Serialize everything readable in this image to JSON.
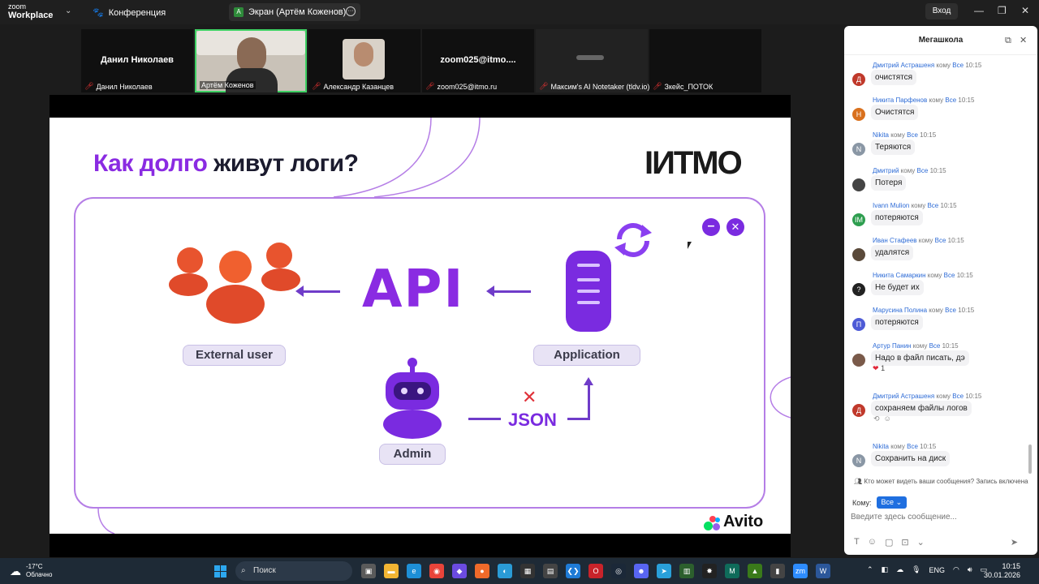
{
  "titlebar": {
    "logo_top": "zoom",
    "logo_bottom": "Workplace",
    "conference": "Конференция",
    "share_badge": "A",
    "share_tab": "Экран (Артём Коженов)",
    "login": "Вход"
  },
  "participants": [
    {
      "center": "Данил Николаев",
      "label": "Данил Николаев"
    },
    {
      "center": "",
      "label": "Артём Коженов"
    },
    {
      "center": "",
      "label": "Александр Казанцев"
    },
    {
      "center": "zoom025@itmo....",
      "label": "zoom025@itmo.ru"
    },
    {
      "center": "",
      "label": "Максим's AI Notetaker (tldv.io)"
    },
    {
      "center": "",
      "label": "Зкейс_ПОТОК"
    }
  ],
  "slide": {
    "title_highlight": "Как долго",
    "title_rest": " живут логи?",
    "brand": "IИTMO",
    "api": "API",
    "external_user": "External user",
    "application": "Application",
    "admin": "Admin",
    "json": "JSON",
    "avito": "Avito"
  },
  "chat": {
    "title": "Мегашкола",
    "to_word": "кому",
    "everyone": "Все",
    "messages": [
      {
        "name": "Дмитрий Астрашеня",
        "time": "10:15",
        "text": "очистятся",
        "avatar": "Д",
        "color": "#c0392b"
      },
      {
        "name": "Никита Парфенов",
        "time": "10:15",
        "text": "Очистятся",
        "avatar": "Н",
        "color": "#d9711e"
      },
      {
        "name": "Nikita",
        "time": "10:15",
        "text": "Теряются",
        "avatar": "N",
        "color": "#8a97a5"
      },
      {
        "name": "Дмитрий",
        "time": "10:15",
        "text": "Потеря",
        "avatar": "",
        "color": "#444"
      },
      {
        "name": "Ivann Mulion",
        "time": "10:15",
        "text": "потеряются",
        "avatar": "IM",
        "color": "#2e9e4f"
      },
      {
        "name": "Иван Стафеев",
        "time": "10:15",
        "text": "удалятся",
        "avatar": "",
        "color": "#5a4a3a"
      },
      {
        "name": "Никита Самаркин",
        "time": "10:15",
        "text": "Не будет их",
        "avatar": "?",
        "color": "#222"
      },
      {
        "name": "Марусина Полина",
        "time": "10:15",
        "text": "потеряются",
        "avatar": "П",
        "color": "#4e5bd6"
      },
      {
        "name": "Артур Панин",
        "time": "10:15",
        "text": "Надо в файл писать, дэ",
        "avatar": "",
        "color": "#7a5a4a"
      },
      {
        "name": "Дмитрий Астрашеня",
        "time": "10:15",
        "text": "сохраняем файлы логов",
        "avatar": "Д",
        "color": "#c0392b"
      },
      {
        "name": "Nikita",
        "time": "10:15",
        "text": "Сохранить на диск",
        "avatar": "N",
        "color": "#8a97a5"
      }
    ],
    "reaction_count": "1",
    "privacy": "Кто может видеть ваши сообщения? Запись включена",
    "to_label": "Кому:",
    "to_value": "Все",
    "input_placeholder": "Введите здесь сообщение..."
  },
  "taskbar": {
    "temp": "-17°C",
    "weather": "Облачно",
    "search": "Поиск",
    "lang": "ENG",
    "time": "10:15",
    "date": "30.01.2026"
  }
}
